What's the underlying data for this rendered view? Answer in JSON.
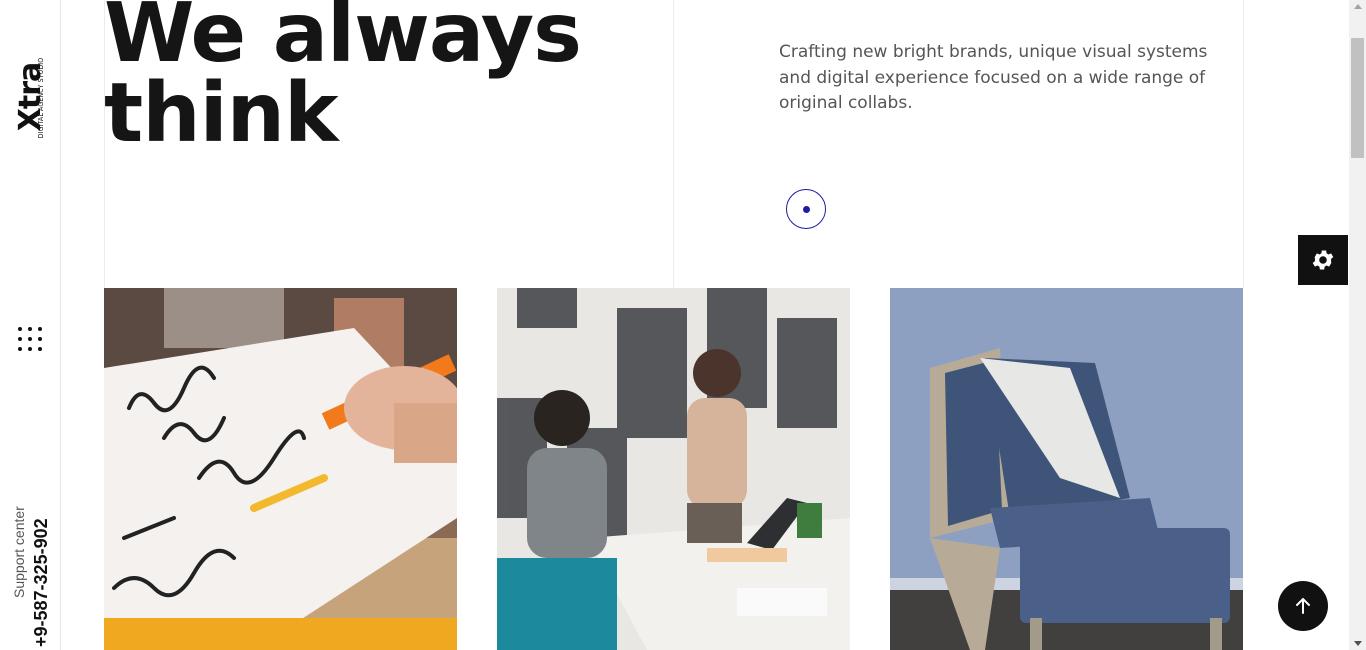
{
  "brand": {
    "logo_text": "Xtra",
    "logo_subtitle": "DIGITAL AGENCY STUDIO"
  },
  "sidebar": {
    "menu_icon": "grid-dots-icon",
    "support_label": "Support center",
    "support_phone": "+9-587-325-902"
  },
  "hero": {
    "title": "We always think",
    "description": "Crafting new bright brands, unique visual systems and digital experience focused on a wide range of original collabs."
  },
  "cards": [
    {
      "name": "business-plan-photo",
      "alt": "Hand writing Business Plan Schedule Marketing in notebook"
    },
    {
      "name": "team-meeting-photo",
      "alt": "Two colleagues in a meeting at an office table"
    },
    {
      "name": "chair-photo",
      "alt": "Blue wooden lounge chair with ottoman and blanket"
    }
  ],
  "controls": {
    "settings_icon": "gear-icon",
    "scroll_top_icon": "arrow-up-icon"
  },
  "colors": {
    "accent": "#1f1aa8",
    "dark": "#111111",
    "text_muted": "#555555"
  }
}
